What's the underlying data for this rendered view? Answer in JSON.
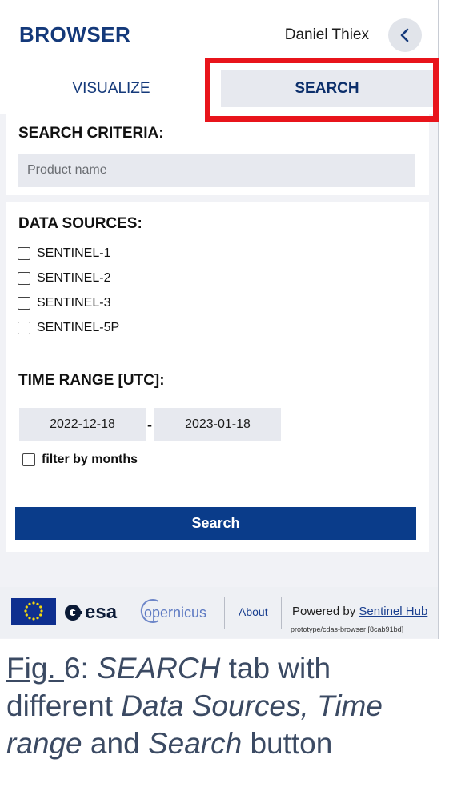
{
  "header": {
    "brand": "BROWSER",
    "user_name": "Daniel Thiex"
  },
  "tabs": [
    {
      "label": "VISUALIZE",
      "active": false
    },
    {
      "label": "SEARCH",
      "active": true
    }
  ],
  "search_criteria": {
    "title": "SEARCH CRITERIA:",
    "product_name_placeholder": "Product name"
  },
  "data_sources": {
    "title": "DATA SOURCES:",
    "items": [
      {
        "label": "SENTINEL-1",
        "checked": false
      },
      {
        "label": "SENTINEL-2",
        "checked": false
      },
      {
        "label": "SENTINEL-3",
        "checked": false
      },
      {
        "label": "SENTINEL-5P",
        "checked": false
      }
    ]
  },
  "time_range": {
    "title": "TIME RANGE [UTC]:",
    "from": "2022-12-18",
    "separator": "-",
    "to": "2023-01-18",
    "filter_label": "filter by months",
    "filter_checked": false
  },
  "search_button": "Search",
  "footer": {
    "esa_label": "esa",
    "copernicus_label": "opernicus",
    "about_label": "About",
    "powered_prefix": "Powered by ",
    "powered_link": "Sentinel Hub",
    "build": "prototype/cdas-browser [8cab91bd]"
  },
  "caption": {
    "fig_label": "Fig. ",
    "fig_number": "6",
    "part1": ": ",
    "part2": "SEARCH",
    "part3": " tab with different ",
    "part4": "Data Sources, Time range",
    "part5": " and ",
    "part6": "Search",
    "part7": " button"
  },
  "colors": {
    "brand": "#14397a",
    "primary_button": "#0a3c8a",
    "highlight": "#e8141b"
  }
}
